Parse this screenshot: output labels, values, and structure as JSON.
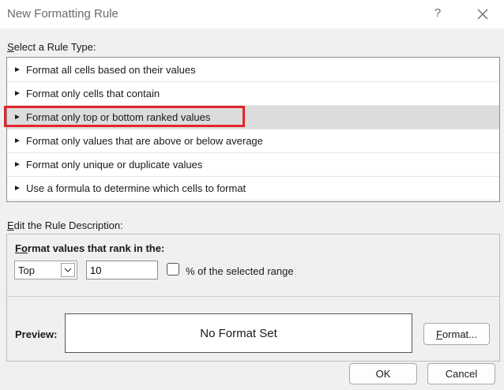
{
  "window": {
    "title": "New Formatting Rule",
    "help": "?"
  },
  "rule_type": {
    "label_prefix": "S",
    "label_rest": "elect a Rule Type:",
    "items": [
      {
        "label": "Format all cells based on their values",
        "selected": false
      },
      {
        "label": "Format only cells that contain",
        "selected": false
      },
      {
        "label": "Format only top or bottom ranked values",
        "selected": true
      },
      {
        "label": "Format only values that are above or below average",
        "selected": false
      },
      {
        "label": "Format only unique or duplicate values",
        "selected": false
      },
      {
        "label": "Use a formula to determine which cells to format",
        "selected": false
      }
    ]
  },
  "description": {
    "label_prefix": "E",
    "label_rest": "dit the Rule Description:",
    "title_prefix": "F",
    "title_mid": "o",
    "title_rest": "rmat values that rank in the:",
    "rank_direction": "Top",
    "rank_value": "10",
    "percent_label_pre": "% of the selected ran",
    "percent_label_u": "g",
    "percent_label_post": "e",
    "percent_checked": false,
    "preview_label": "Preview:",
    "preview_text": "No Format Set",
    "format_button_u": "F",
    "format_button_rest": "ormat..."
  },
  "buttons": {
    "ok": "OK",
    "cancel": "Cancel"
  },
  "colors": {
    "highlight": "#e3262c",
    "selected_row": "#dcdcdc"
  }
}
